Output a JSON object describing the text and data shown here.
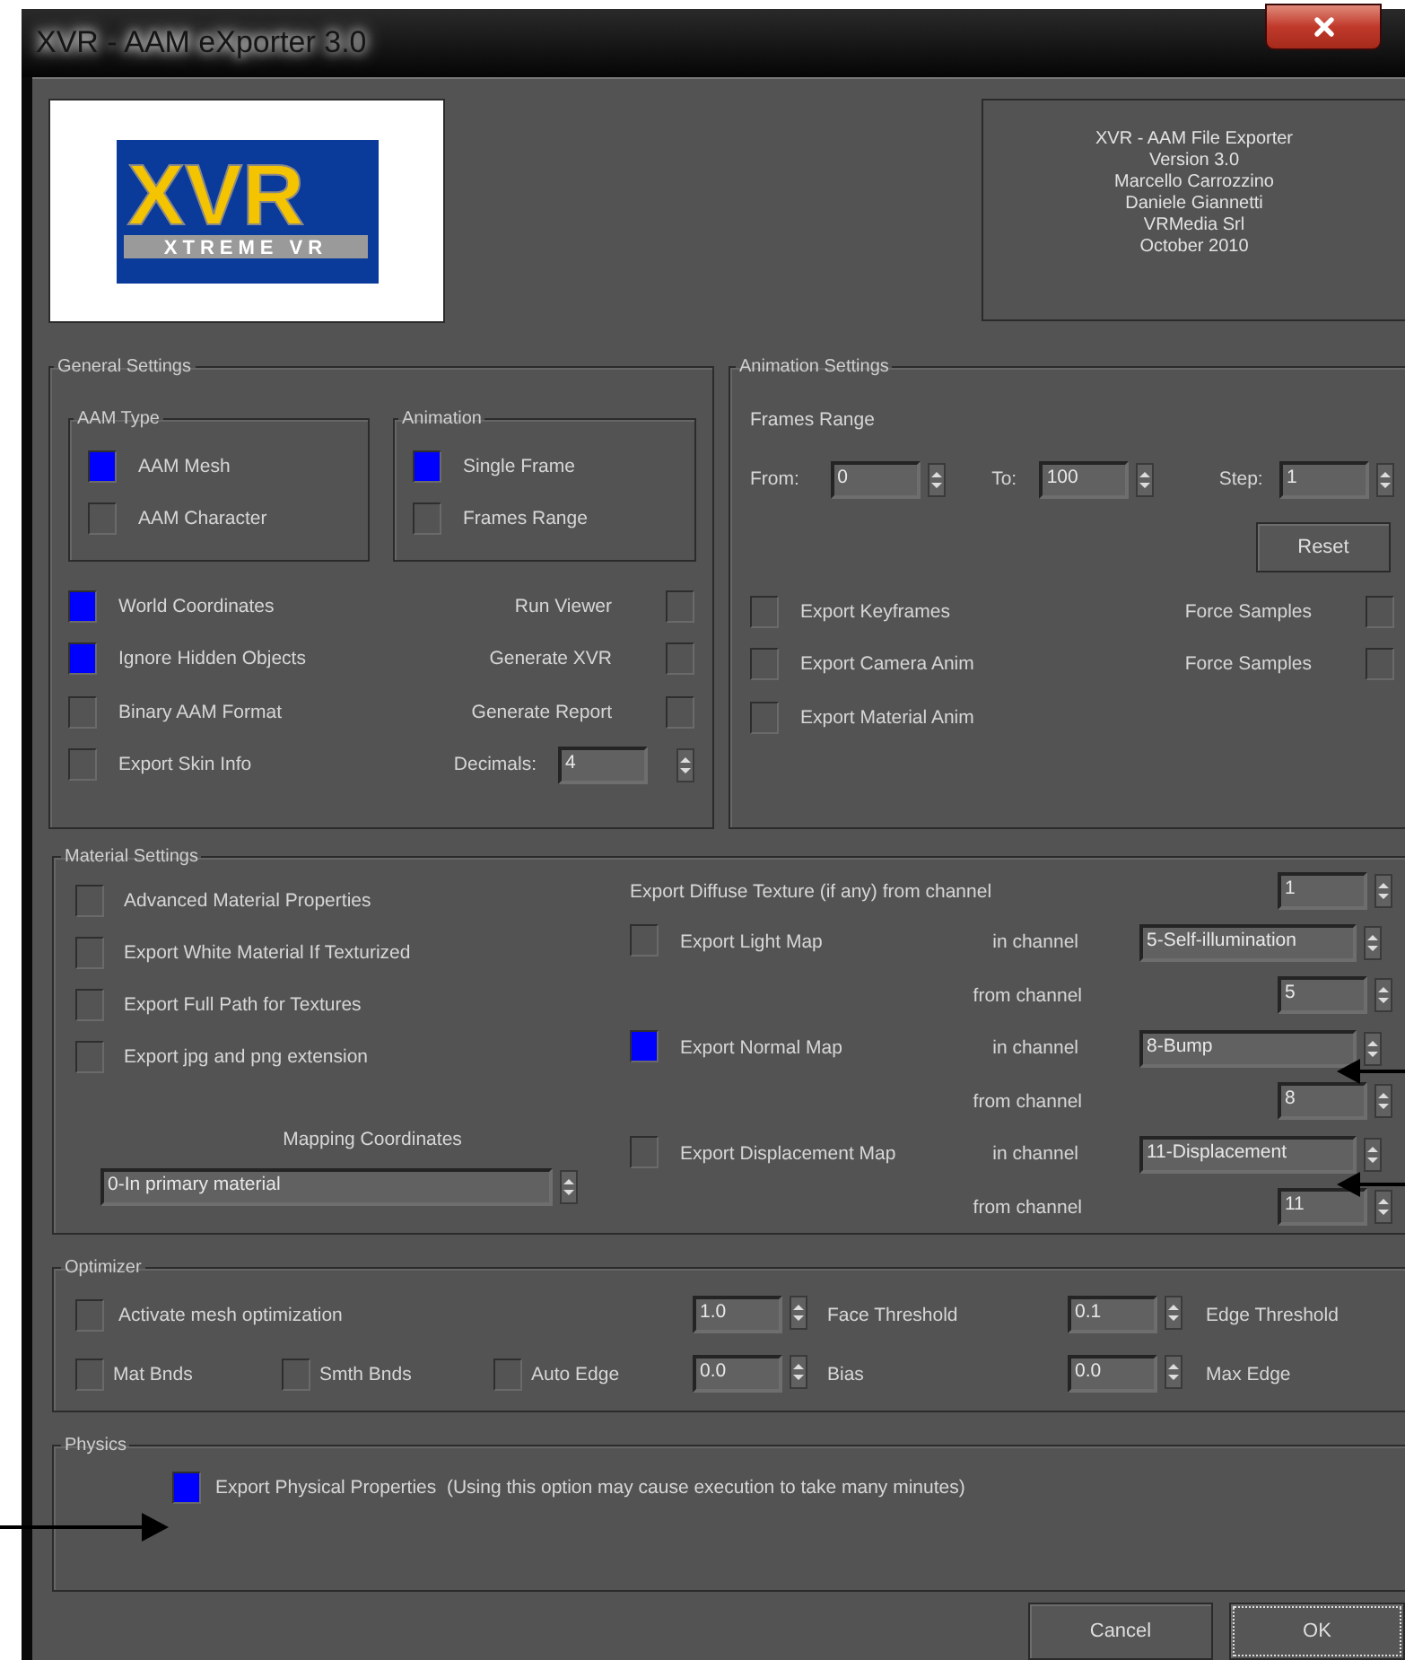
{
  "window": {
    "title": "XVR - AAM eXporter 3.0"
  },
  "logo": {
    "mark": "XVR",
    "tagline": "XTREME VR"
  },
  "about": {
    "lines": [
      "XVR - AAM File Exporter",
      "Version 3.0",
      "Marcello Carrozzino",
      "Daniele Giannetti",
      "VRMedia Srl",
      "October 2010"
    ]
  },
  "general_settings": {
    "title": "General Settings",
    "aam_type": {
      "title": "AAM Type",
      "options": [
        {
          "label": "AAM Mesh",
          "selected": true
        },
        {
          "label": "AAM Character",
          "selected": false
        }
      ]
    },
    "animation": {
      "title": "Animation",
      "options": [
        {
          "label": "Single Frame",
          "selected": true
        },
        {
          "label": "Frames Range",
          "selected": false
        }
      ]
    },
    "left_options": [
      {
        "label": "World Coordinates",
        "checked": true
      },
      {
        "label": "Ignore Hidden Objects",
        "checked": true
      },
      {
        "label": "Binary AAM Format",
        "checked": false
      },
      {
        "label": "Export Skin Info",
        "checked": false
      }
    ],
    "right_items": [
      {
        "kind": "checkbox",
        "label": "Run Viewer",
        "checked": false
      },
      {
        "kind": "checkbox",
        "label": "Generate XVR",
        "checked": false
      },
      {
        "kind": "checkbox",
        "label": "Generate Report",
        "checked": false
      },
      {
        "kind": "spinner",
        "label": "Decimals:",
        "value": "4"
      }
    ]
  },
  "animation_settings": {
    "title": "Animation Settings",
    "frames_range": "Frames Range",
    "range_fields": [
      {
        "label": "From:",
        "value": "0"
      },
      {
        "label": "To:",
        "value": "100"
      },
      {
        "label": "Step:",
        "value": "1"
      }
    ],
    "reset_button": "Reset",
    "rows": [
      {
        "label": "Export Keyframes",
        "checked": false,
        "right": {
          "label": "Force Samples",
          "checked": false
        }
      },
      {
        "label": "Export Camera Anim",
        "checked": false,
        "right": {
          "label": "Force Samples",
          "checked": false
        }
      },
      {
        "label": "Export Material Anim",
        "checked": false
      }
    ]
  },
  "material_settings": {
    "title": "Material Settings",
    "options": [
      {
        "label": "Advanced Material Properties",
        "checked": false
      },
      {
        "label": "Export White Material If Texturized",
        "checked": false
      },
      {
        "label": "Export Full Path for Textures",
        "checked": false
      },
      {
        "label": "Export jpg and png extension",
        "checked": false
      }
    ],
    "mapping_label": "Mapping Coordinates",
    "mapping_value": "0-In primary material",
    "diffuse": {
      "label": "Export Diffuse Texture (if any) from channel",
      "value": "1"
    },
    "maps": [
      {
        "label": "Export Light Map",
        "checked": false,
        "in_label": "in channel",
        "in_value": "5-Self-illumination",
        "from_label": "from channel",
        "from_value": "5"
      },
      {
        "label": "Export Normal Map",
        "checked": true,
        "in_label": "in channel",
        "in_value": "8-Bump",
        "from_label": "from channel",
        "from_value": "8"
      },
      {
        "label": "Export Displacement Map",
        "checked": false,
        "in_label": "in channel",
        "in_value": "11-Displacement",
        "from_label": "from channel",
        "from_value": "11"
      }
    ]
  },
  "optimizer": {
    "title": "Optimizer",
    "activate": {
      "label": "Activate mesh optimization",
      "checked": false
    },
    "flags": [
      {
        "label": "Mat Bnds",
        "checked": false
      },
      {
        "label": "Smth Bnds",
        "checked": false
      },
      {
        "label": "Auto Edge",
        "checked": false
      }
    ],
    "face_threshold": {
      "value": "1.0",
      "label": "Face Threshold"
    },
    "edge_threshold": {
      "value": "0.1",
      "label": "Edge Threshold"
    },
    "bias": {
      "value": "0.0",
      "label": "Bias"
    },
    "max_edge": {
      "value": "0.0",
      "label": "Max Edge"
    }
  },
  "physics": {
    "title": "Physics",
    "option": {
      "label": "Export Physical Properties  (Using this option may cause execution to take many minutes)",
      "checked": true
    }
  },
  "buttons": [
    {
      "label": "Cancel",
      "focused": false
    },
    {
      "label": "OK",
      "focused": true
    }
  ]
}
